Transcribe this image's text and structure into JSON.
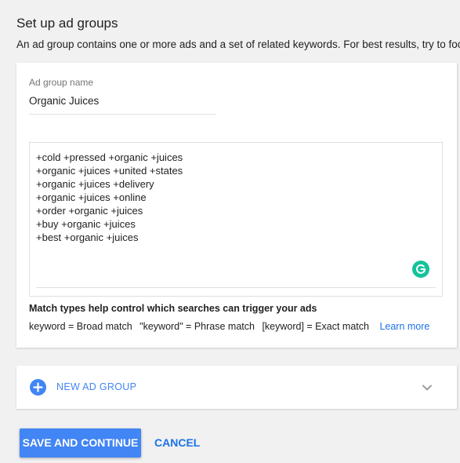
{
  "page": {
    "title": "Set up ad groups",
    "description": "An ad group contains one or more ads and a set of related keywords. For best results, try to focus a"
  },
  "ad_group": {
    "name_label": "Ad group name",
    "name_value": "Organic Juices",
    "keywords": [
      "+cold +pressed +organic +juices",
      "+organic +juices +united +states",
      "+organic +juices +delivery",
      "+organic +juices +online",
      "+order +organic +juices",
      "+buy +organic +juices",
      "+best +organic +juices"
    ],
    "match_types_title": "Match types help control which searches can trigger your ads",
    "match_broad": "keyword = Broad match",
    "match_phrase": "\"keyword\" = Phrase match",
    "match_exact": "[keyword] = Exact match",
    "learn_more": "Learn more",
    "grammarly_icon": "grammarly-icon"
  },
  "new_ad_group": {
    "label": "NEW AD GROUP",
    "icon": "plus-circle-icon",
    "expand_icon": "chevron-down-icon"
  },
  "actions": {
    "save_label": "SAVE AND CONTINUE",
    "cancel_label": "CANCEL"
  },
  "colors": {
    "accent": "#4285f4",
    "link": "#1a73e8",
    "grammarly": "#15c39a"
  }
}
